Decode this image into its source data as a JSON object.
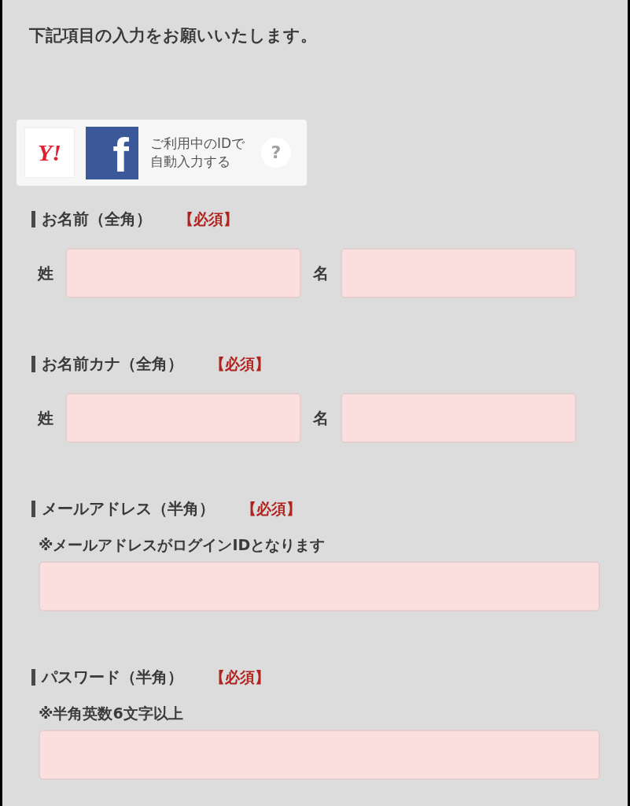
{
  "intro": "下記項目の入力をお願いいたします。",
  "autofill": {
    "providers": [
      {
        "kind": "yahoo",
        "logo": "Y!"
      },
      {
        "kind": "facebook",
        "logo": "f"
      }
    ],
    "caption": [
      "ご利用中のIDで",
      "自動入力する"
    ],
    "help": "?"
  },
  "sections": [
    {
      "title": "お名前（全角）",
      "required": "【必須】",
      "kind": "split",
      "fields": [
        {
          "label": "姓"
        },
        {
          "label": "名"
        }
      ]
    },
    {
      "title": "お名前カナ（全角）",
      "required": "【必須】",
      "kind": "split",
      "fields": [
        {
          "label": "姓"
        },
        {
          "label": "名"
        }
      ]
    },
    {
      "title": "メールアドレス（半角）",
      "required": "【必須】",
      "kind": "single",
      "note": "※メールアドレスがログインIDとなります"
    },
    {
      "title": "パスワード（半角）",
      "required": "【必須】",
      "kind": "single",
      "note": "※半角英数6文字以上"
    }
  ]
}
